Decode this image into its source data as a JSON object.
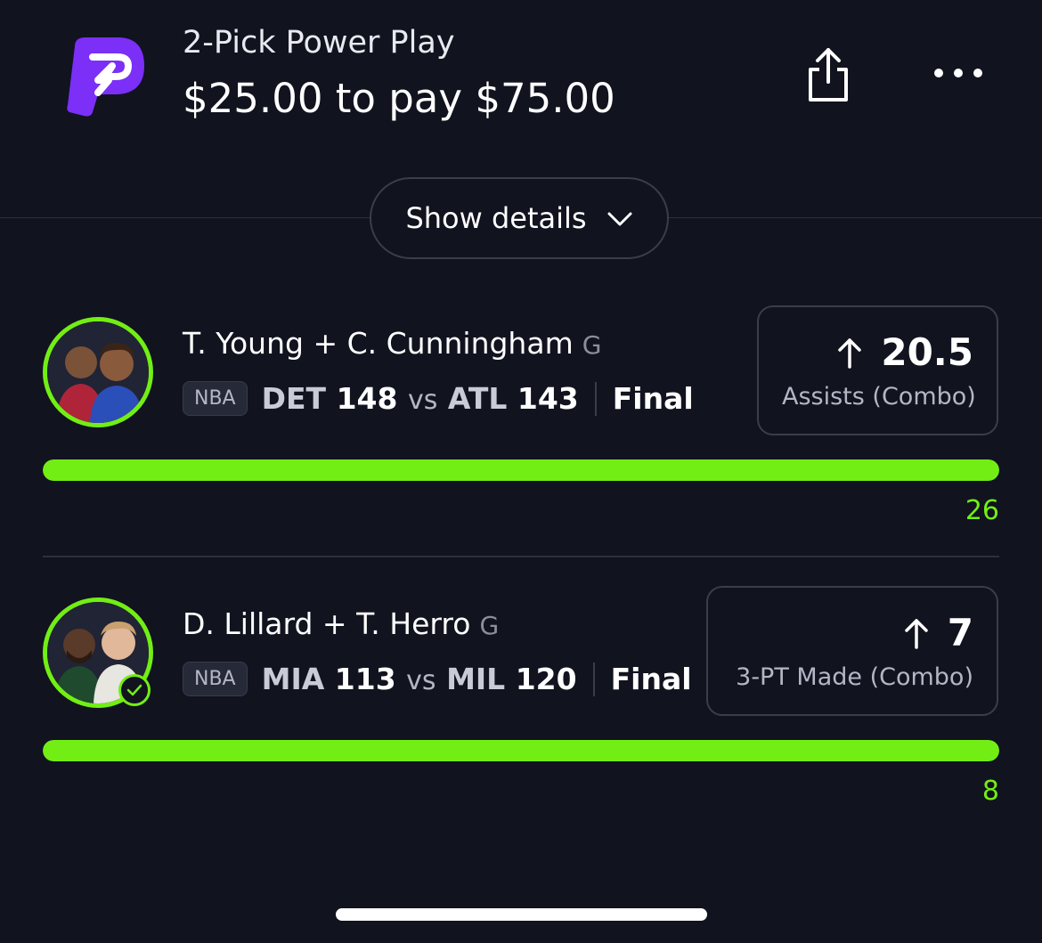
{
  "header": {
    "logo_icon": "prizepicks-logo-icon",
    "title": "2-Pick Power Play",
    "subtitle": "$25.00 to pay $75.00",
    "share_icon": "share-icon",
    "more_icon": "more-dots-icon"
  },
  "show_details": {
    "label": "Show details",
    "icon": "chevron-down-icon"
  },
  "picks": [
    {
      "players": "T. Young + C. Cunningham",
      "position": "G",
      "league": "NBA",
      "team1": "DET",
      "score1": "148",
      "vs": "vs",
      "team2": "ATL",
      "score2": "143",
      "status": "Final",
      "direction_icon": "arrow-up-icon",
      "line": "20.5",
      "stat": "Assists (Combo)",
      "actual": "26",
      "progress": 1.0,
      "won": false
    },
    {
      "players": "D. Lillard + T. Herro",
      "position": "G",
      "league": "NBA",
      "team1": "MIA",
      "score1": "113",
      "vs": "vs",
      "team2": "MIL",
      "score2": "120",
      "status": "Final",
      "direction_icon": "arrow-up-icon",
      "line": "7",
      "stat": "3-PT Made (Combo)",
      "actual": "8",
      "progress": 1.0,
      "won": true
    }
  ],
  "colors": {
    "background": "#11131f",
    "accent": "#72ee14",
    "brand": "#7b2ff7",
    "border": "#3a3d4b"
  }
}
